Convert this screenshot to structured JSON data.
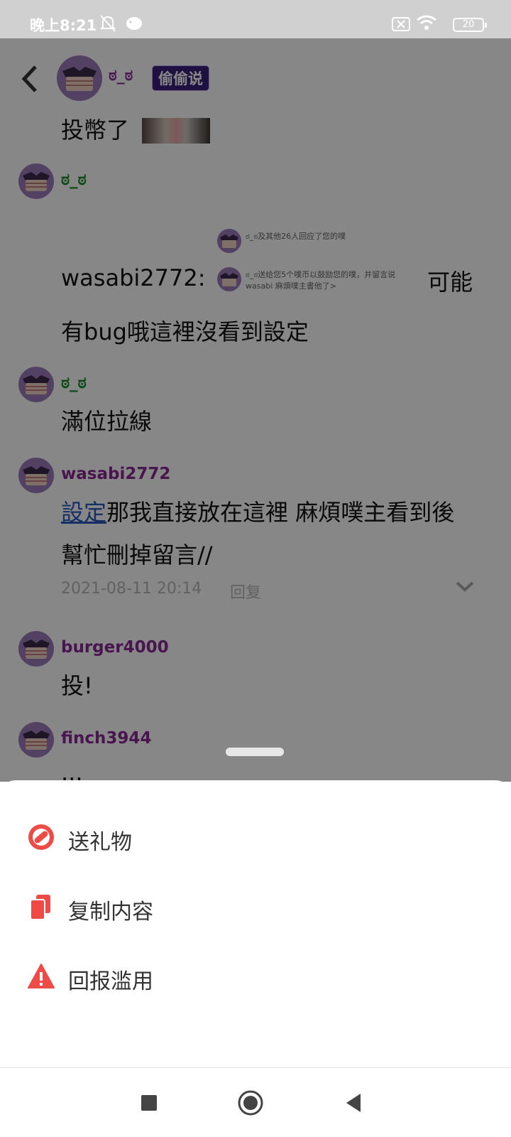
{
  "status_bar": {
    "time": "晚上8:21",
    "battery": "20",
    "icons": [
      "bell-off-icon",
      "bird-icon",
      "sim-off-icon",
      "wifi-icon",
      "battery-icon"
    ]
  },
  "header": {
    "author": "ಠ_ಠ",
    "badge": "偷偷说",
    "post_text": "投幣了"
  },
  "comments": [
    {
      "user": "ಠ_ಠ",
      "prefix": "wasabi2772:",
      "suffix": "可能",
      "line2": "有bug哦這裡沒看到設定",
      "card_line1": "ಠ_ಠ及其他26人回应了您的噗",
      "card_line2": "ಠ_ಠ送给您5个噗币以鼓励您的噗，并留言说",
      "card_line3": "wasabi 麻煩噗主書他了>"
    },
    {
      "user": "ಠ_ಠ",
      "text": "滿位拉線"
    },
    {
      "user": "wasabi2772",
      "link": "設定",
      "text": "那我直接放在這裡 麻煩噗主看到後",
      "line2": "幫忙刪掉留言//",
      "time": "2021-08-11 20:14",
      "reply": "回复"
    },
    {
      "user": "burger4000",
      "text": "投!"
    },
    {
      "user": "finch3944",
      "text": "..."
    }
  ],
  "sheet": {
    "items": [
      {
        "label": "送礼物",
        "icon": "gift-icon"
      },
      {
        "label": "复制内容",
        "icon": "copy-icon"
      },
      {
        "label": "回报滥用",
        "icon": "warning-icon"
      }
    ]
  },
  "navbar": {
    "icons": [
      "square-recents-icon",
      "circle-home-icon",
      "triangle-back-icon"
    ]
  },
  "colors": {
    "accent_red": "#ee4b46",
    "username_purple": "#8a2896",
    "username_green": "#118a26",
    "badge_bg": "#3a1f7a"
  }
}
